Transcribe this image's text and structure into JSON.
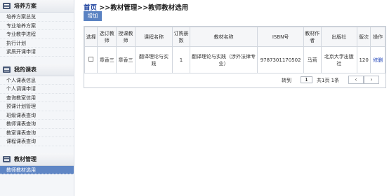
{
  "sidebar": {
    "sections": [
      {
        "title": "培养方案",
        "items": [
          "培养方案总览",
          "专业培养方案",
          "专业教学进程",
          "执行计划",
          "紧质开课申请"
        ]
      },
      {
        "title": "我的课表",
        "items": [
          "个人课表信息",
          "个人调课申请",
          "查询教室信用",
          "预课计划管理",
          "班级课表查询",
          "教师课表查询",
          "教室课表查询",
          "课程课表查询"
        ]
      },
      {
        "title": "教材管理",
        "items": [
          "教师教材选用"
        ]
      }
    ]
  },
  "breadcrumb": {
    "home": "首页",
    "rest": " >>教材管理>>教师教材选用"
  },
  "toolbar": {
    "add_label": "增加"
  },
  "table": {
    "headers": [
      "选择",
      "选订教师",
      "授课教师",
      "课程名称",
      "订购册数",
      "教材名称",
      "ISBN号",
      "教材作者",
      "出版社",
      "版次",
      "操作"
    ],
    "rows": [
      {
        "order_teacher": "章香三",
        "teach_teacher": "章香三",
        "course": "翻译理论与实践",
        "copies": "1",
        "textbook": "翻译理论与实践（涉外法律专业）",
        "isbn": "9787301170502",
        "author": "马莉",
        "publisher": "北京大学出版社",
        "edition": "120",
        "op": "修删"
      }
    ]
  },
  "pager": {
    "goto_label": "转到",
    "page_value": "1",
    "total_label": "共1页 1条",
    "prev_label": "‹",
    "next_label": "›"
  }
}
